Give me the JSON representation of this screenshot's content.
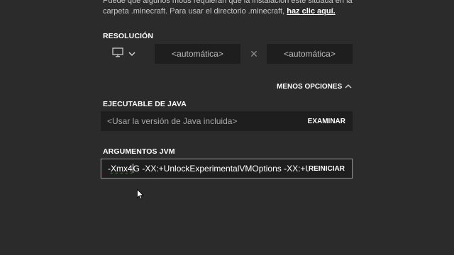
{
  "info": {
    "line1": "Puede que algunos mods requieran que la instalación esté situada en la",
    "line2_prefix": "carpeta .minecraft. Para usar el directorio .minecraft, ",
    "link": "haz clic aquí."
  },
  "resolution": {
    "label": "RESOLUCIÓN",
    "width_placeholder": "<automática>",
    "height_placeholder": "<automática>",
    "separator": "✕"
  },
  "options_toggle": {
    "label": "MENOS OPCIONES",
    "icon": "chevron-up-icon"
  },
  "java": {
    "label": "EJECUTABLE DE JAVA",
    "placeholder": "<Usar la versión de Java incluida>",
    "button": "EXAMINAR"
  },
  "jvm": {
    "label": "ARGUMENTOS JVM",
    "value_before_caret": "-Xmx4",
    "value_after_caret": "G -XX:+UnlockExperimentalVMOptions -XX:+U",
    "button": "REINICIAR"
  }
}
